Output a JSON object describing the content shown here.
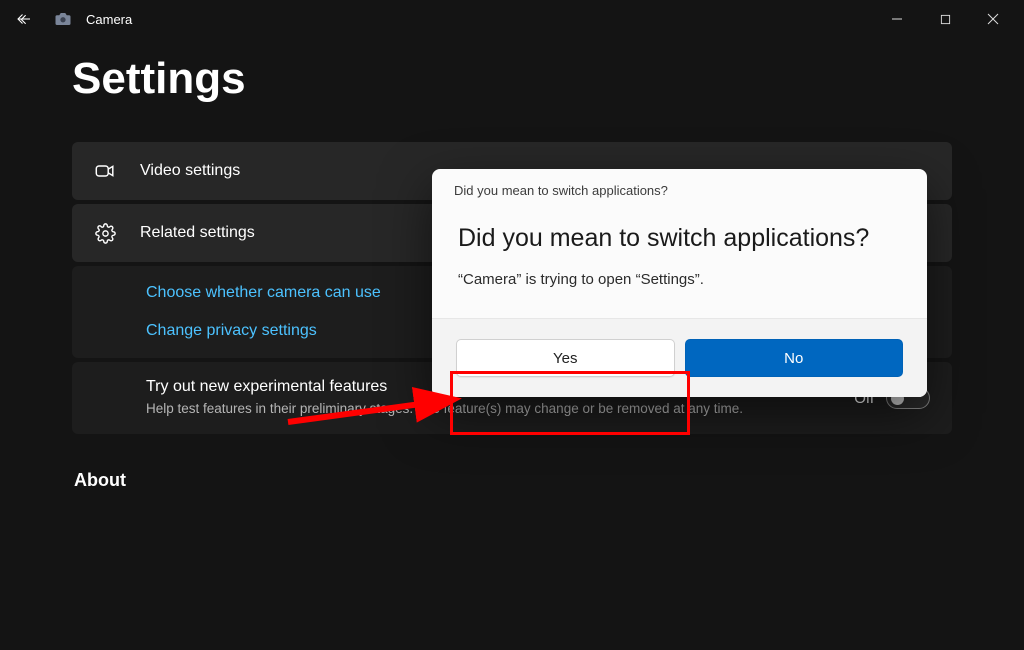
{
  "titlebar": {
    "app_name": "Camera"
  },
  "page": {
    "title": "Settings"
  },
  "cards": {
    "video_settings": "Video settings",
    "related_settings": "Related settings"
  },
  "links": {
    "choose_camera": "Choose whether camera can use",
    "privacy": "Change privacy settings"
  },
  "experiment": {
    "title": "Try out new experimental features",
    "desc": "Help test features in their preliminary stages. The feature(s) may change or be removed at any time.",
    "state": "Off"
  },
  "about_heading": "About",
  "dialog": {
    "titlebar": "Did you mean to switch applications?",
    "heading": "Did you mean to switch applications?",
    "text": "“Camera” is trying to open “Settings”.",
    "yes": "Yes",
    "no": "No"
  }
}
